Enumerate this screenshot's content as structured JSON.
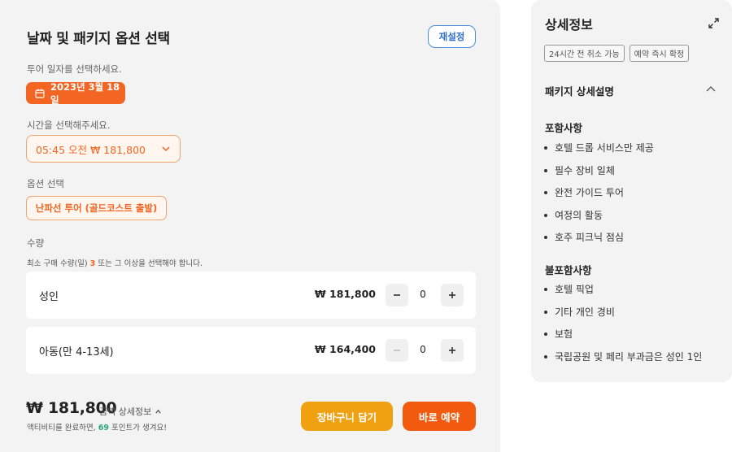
{
  "booking": {
    "title": "날짜 및 패키지 옵션 선택",
    "reset_label": "재설정",
    "date_prompt": "투어 일자를 선택하세요.",
    "date_value": "2023년 3월 18일",
    "time_prompt": "시간을 선택해주세요.",
    "time_value": "05:45 오전 ₩ 181,800",
    "option_prompt": "옵션 선택",
    "option_value": "난파선 투어 (골드코스트 출발)",
    "quantity_label": "수량",
    "min_note_prefix": "최소 구매 수량(일)",
    "min_note_number": "3",
    "min_note_suffix": "또는 그 이상을 선택해야 합니다.",
    "quantities": [
      {
        "name": "성인",
        "price": "₩ 181,800",
        "count": "0"
      },
      {
        "name": "아동(만 4-13세)",
        "price": "₩ 164,400",
        "count": "0"
      }
    ],
    "total": "₩ 181,800",
    "total_detail_label": "금액 상세정보",
    "points_prefix": "액티비티를 완료하면,",
    "points_value": "69",
    "points_suffix": "포인트가 생겨요!",
    "cart_label": "장바구니 담기",
    "book_label": "바로 예약"
  },
  "details": {
    "title": "상세정보",
    "tags": [
      "24시간 전 취소 가능",
      "예약 즉시 확정"
    ],
    "package_heading": "패키지 상세설명",
    "included_heading": "포함사항",
    "included": [
      "호텔 드롭 서비스만 제공",
      "필수 장비 일체",
      "완전 가이드 투어",
      "여정의 활동",
      "호주 피크닉 점심"
    ],
    "excluded_heading": "불포함사항",
    "excluded": [
      "호텔 픽업",
      "기타 개인 경비",
      "보험",
      "국립공원 및 페리 부과금은 성인 1인"
    ]
  },
  "colors": {
    "accent_orange": "#f26522",
    "cart_yellow": "#f0a112",
    "reset_blue": "#2f6fc9",
    "points_green": "#2aa876"
  }
}
